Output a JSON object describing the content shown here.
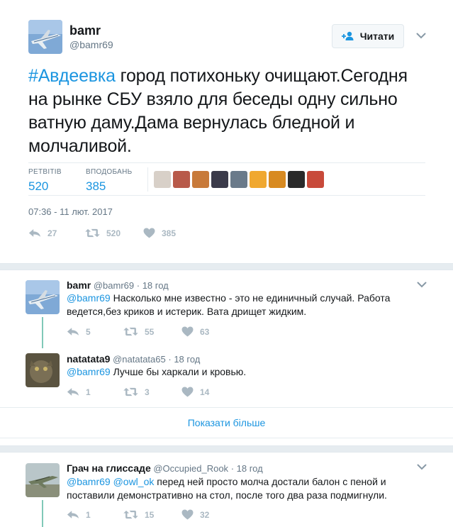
{
  "main_tweet": {
    "name": "bamr",
    "handle": "@bamr69",
    "follow_label": "Читати",
    "text_hashtag": "#Авдеевка",
    "text_body": " город потихоньку очищают.Сегодня на рынке СБУ взяло для беседы одну сильно ватную даму.Дама вернулась бледной и молчаливой.",
    "retweets_label": "РЕТВІТІВ",
    "retweets_count": "520",
    "likes_label": "ВПОДОБАНЬ",
    "likes_count": "385",
    "timestamp": "07:36 - 11 лют. 2017",
    "actions": {
      "replies": "27",
      "retweets": "520",
      "likes": "385"
    },
    "liker_colors": [
      "#d8d0c8",
      "#b85a4a",
      "#c87a3a",
      "#3a3a4a",
      "#6a7a8a",
      "#f0a830",
      "#d88a20",
      "#2a2a2a",
      "#c84a3a"
    ]
  },
  "replies": [
    {
      "name": "bamr",
      "handle": "@bamr69",
      "time": "· 18 год",
      "mention": "@bamr69",
      "text": " Насколько мне известно - это не единичный случай. Работа ведется,без криков и истерик. Вата дрищет жидким.",
      "actions": {
        "replies": "5",
        "retweets": "55",
        "likes": "63"
      }
    },
    {
      "name": "natatata9",
      "handle": "@natatata65",
      "time": "· 18 год",
      "mention": "@bamr69",
      "text": " Лучше бы харкали и кровью.",
      "actions": {
        "replies": "1",
        "retweets": "3",
        "likes": "14"
      }
    },
    {
      "name": "Грач на глиссаде",
      "handle": "@Occupied_Rook",
      "time": "· 18 год",
      "mention": "@bamr69",
      "mention2": "@owl_ok",
      "text": " перед ней просто молча достали балон с пеной и поставили демонстративно на стол, после того два раза подмигнули.",
      "actions": {
        "replies": "1",
        "retweets": "15",
        "likes": "32"
      }
    }
  ],
  "show_more": "Показати більше",
  "icons": {
    "reply": "reply-icon",
    "retweet": "retweet-icon",
    "like": "heart-icon",
    "follow": "follow-person-icon",
    "more": "chevron-down-icon"
  },
  "colors": {
    "link": "#1b95e0",
    "muted": "#657786",
    "action_icon": "#aab8c2",
    "thread": "#80c9b8"
  }
}
